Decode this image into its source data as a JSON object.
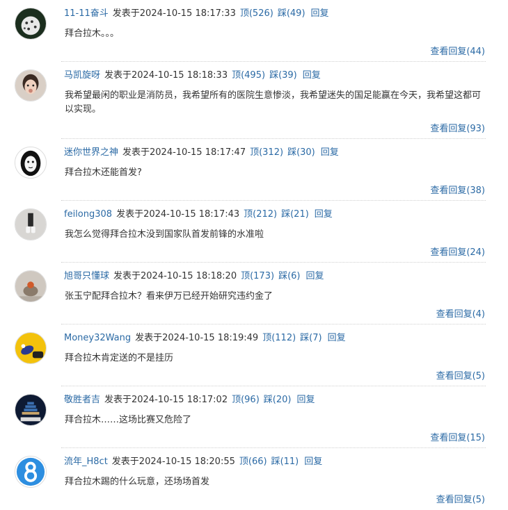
{
  "comments": [
    {
      "username": "11-11奋斗",
      "posted": "发表于2024-10-15 18:17:33",
      "up": "顶(526)",
      "down": "踩(49)",
      "reply": "回复",
      "content": "拜合拉木。。。",
      "view_replies": "查看回复(44)"
    },
    {
      "username": "马凯旋呀",
      "posted": "发表于2024-10-15 18:18:33",
      "up": "顶(495)",
      "down": "踩(39)",
      "reply": "回复",
      "content": "我希望最闲的职业是消防员，我希望所有的医院生意惨淡，我希望迷失的国足能赢在今天，我希望这都可以实现。",
      "view_replies": "查看回复(93)"
    },
    {
      "username": "迷你世界之神",
      "posted": "发表于2024-10-15 18:17:47",
      "up": "顶(312)",
      "down": "踩(30)",
      "reply": "回复",
      "content": "拜合拉木还能首发?",
      "view_replies": "查看回复(38)"
    },
    {
      "username": "feilong308",
      "posted": "发表于2024-10-15 18:17:43",
      "up": "顶(212)",
      "down": "踩(21)",
      "reply": "回复",
      "content": "我怎么觉得拜合拉木没到国家队首发前锋的水准啦",
      "view_replies": "查看回复(24)"
    },
    {
      "username": "旭哥只懂球",
      "posted": "发表于2024-10-15 18:18:20",
      "up": "顶(173)",
      "down": "踩(6)",
      "reply": "回复",
      "content": "张玉宁配拜合拉木？看来伊万已经开始研究违约金了",
      "view_replies": "查看回复(4)"
    },
    {
      "username": "Money32Wang",
      "posted": "发表于2024-10-15 18:19:49",
      "up": "顶(112)",
      "down": "踩(7)",
      "reply": "回复",
      "content": "拜合拉木肯定送的不是挂历",
      "view_replies": "查看回复(5)"
    },
    {
      "username": "敬胜者吉",
      "posted": "发表于2024-10-15 18:17:02",
      "up": "顶(96)",
      "down": "踩(20)",
      "reply": "回复",
      "content": "拜合拉木……这场比赛又危险了",
      "view_replies": "查看回复(15)"
    },
    {
      "username": "流年_H8ct",
      "posted": "发表于2024-10-15 18:20:55",
      "up": "顶(66)",
      "down": "踩(11)",
      "reply": "回复",
      "content": "拜合拉木踢的什么玩意，还场场首发",
      "view_replies": "查看回复(5)"
    }
  ],
  "colors": {
    "link": "#2b6aa5",
    "text": "#333333",
    "divider": "#cfcfcf",
    "avatar8": "#2d8ee0"
  }
}
